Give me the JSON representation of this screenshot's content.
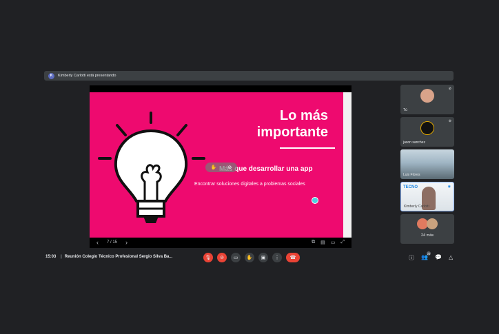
{
  "presenter_banner": {
    "avatar": "K",
    "text": "Kimberly Carlotti está presentando"
  },
  "slide": {
    "title_line1": "Lo más",
    "title_line2": "importante",
    "subtitle": "Más que desarrollar una app",
    "body": "Encontrar soluciones digitales a problemas sociales",
    "bg_color": "#ee0a6f",
    "icon": "lightbulb-icon",
    "counter": "7 / 15",
    "progress": 0.47
  },
  "participants": [
    {
      "name": "Tú"
    },
    {
      "name": "jason sanchez"
    },
    {
      "name": "Luis Flores"
    },
    {
      "name": "Kimberly Carlotti",
      "logo": "TECNO"
    },
    {
      "name": "24 más"
    }
  ],
  "footer": {
    "time": "15:03",
    "meeting_title": "Reunión Colegio Técnico Profesional Sergio Silva Ba..."
  },
  "right_badge": "26",
  "colors": {
    "danger": "#ea4335",
    "surface": "#3c4043",
    "background": "#202124"
  }
}
